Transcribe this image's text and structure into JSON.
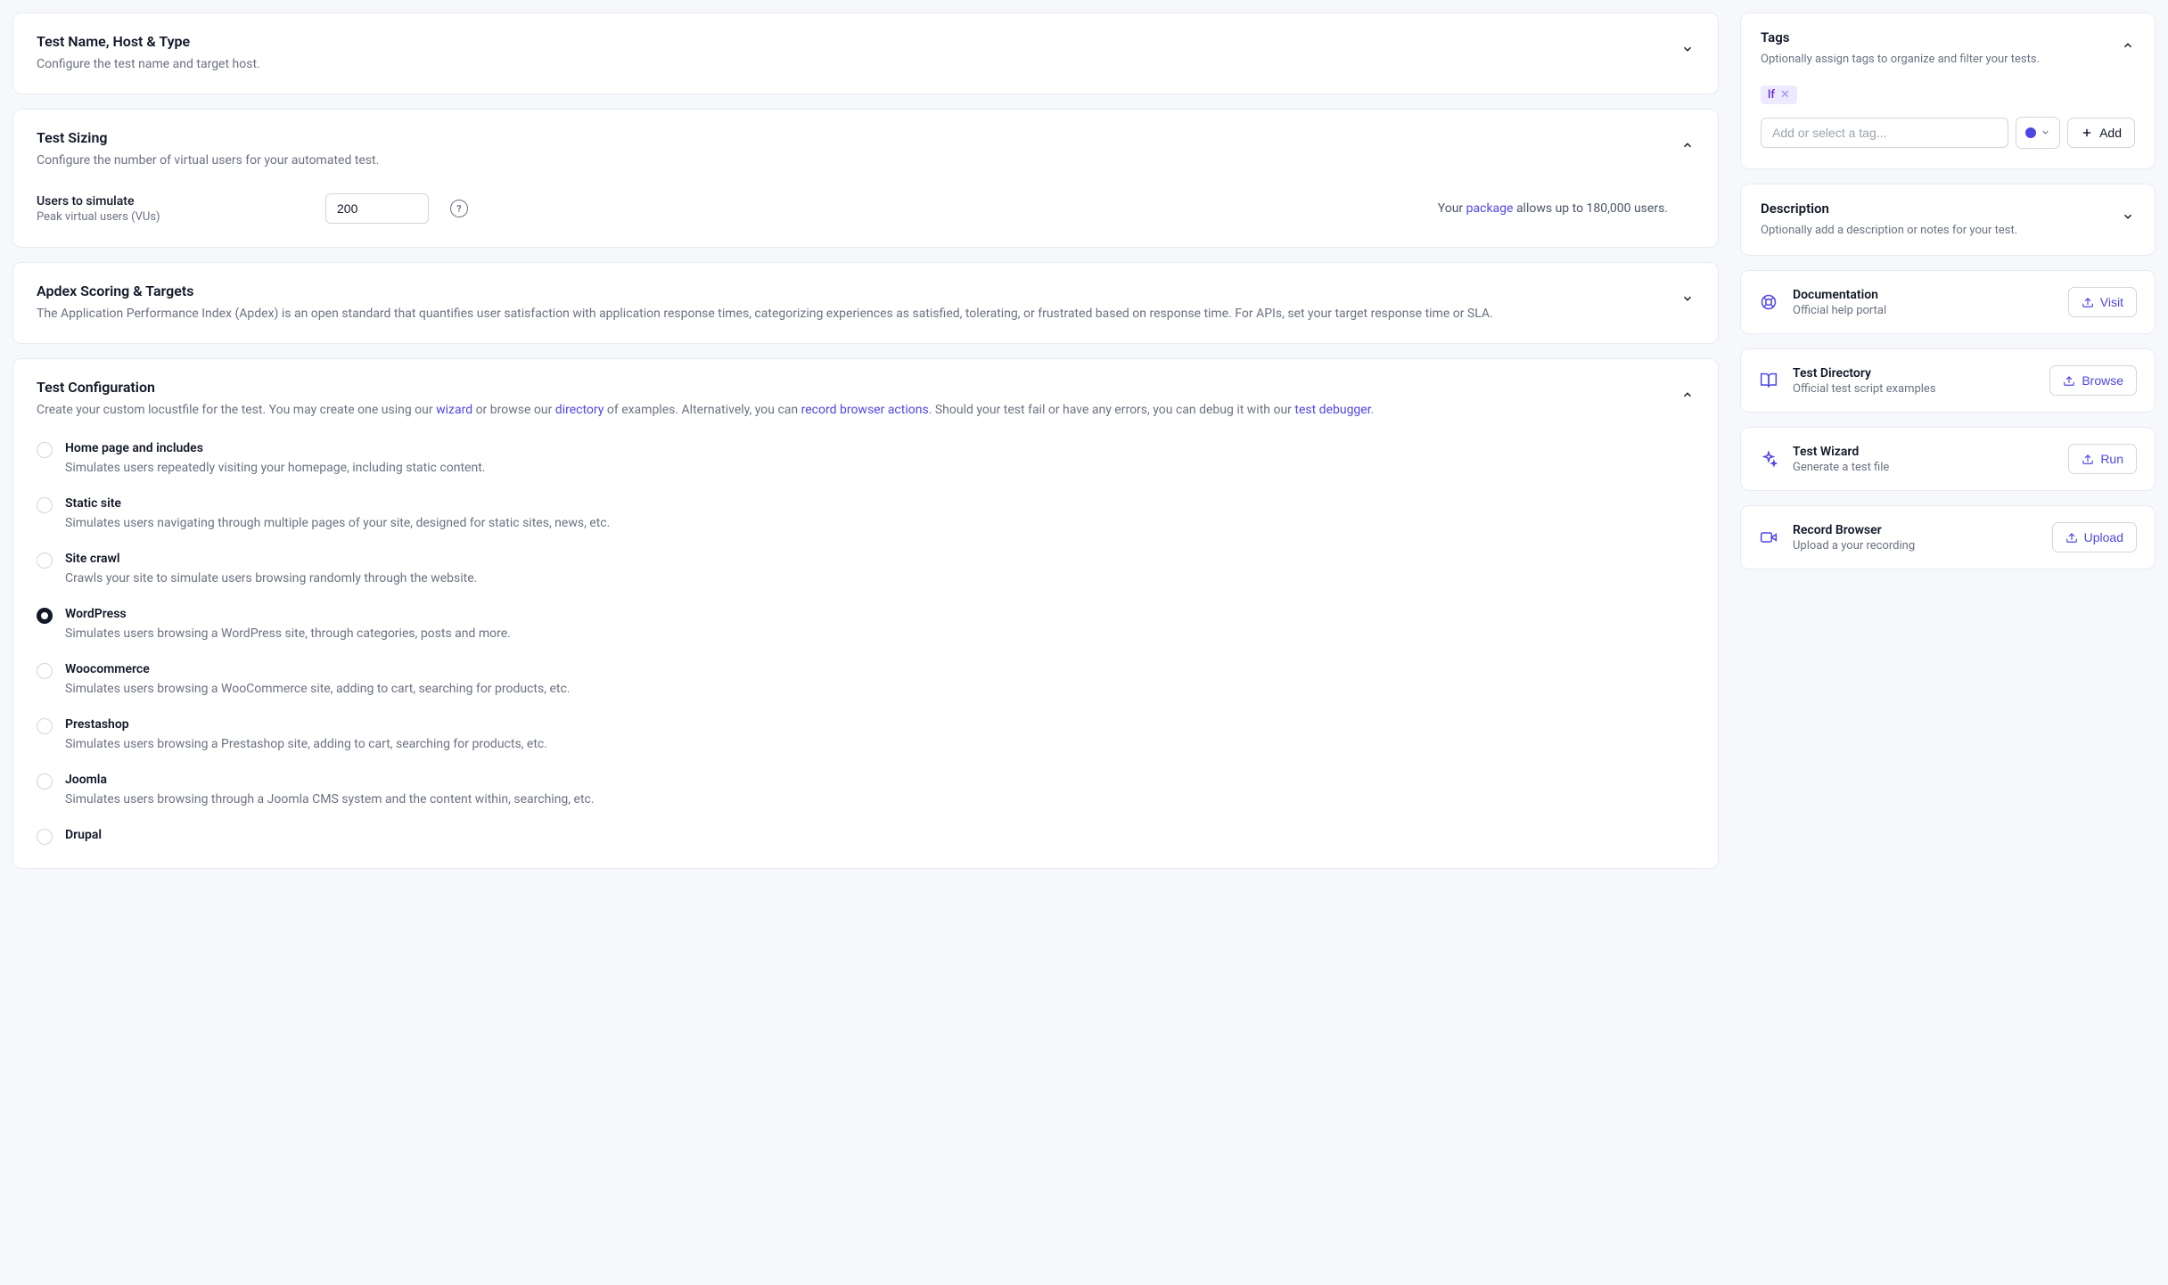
{
  "sections": {
    "nameHost": {
      "title": "Test Name, Host & Type",
      "subtitle": "Configure the test name and target host."
    },
    "sizing": {
      "title": "Test Sizing",
      "subtitle": "Configure the number of virtual users for your automated test.",
      "field_label": "Users to simulate",
      "field_hint": "Peak virtual users (VUs)",
      "value": "200",
      "note_prefix": "Your ",
      "note_link": "package",
      "note_suffix": " allows up to 180,000 users."
    },
    "apdex": {
      "title": "Apdex Scoring & Targets",
      "subtitle": "The Application Performance Index (Apdex) is an open standard that quantifies user satisfaction with application response times, categorizing experiences as satisfied, tolerating, or frustrated based on response time. For APIs, set your target response time or SLA."
    },
    "config": {
      "title": "Test Configuration",
      "sub_parts": {
        "p1": "Create your custom locustfile for the test. You may create one using our ",
        "wizard": "wizard",
        "p2": " or browse our ",
        "directory": "directory",
        "p3": " of examples. Alternatively, you can ",
        "record": "record browser actions",
        "p4": ". Should your test fail or have any errors, you can debug it with our ",
        "debugger": "test debugger",
        "p5": "."
      },
      "options": [
        {
          "title": "Home page and includes",
          "desc": "Simulates users repeatedly visiting your homepage, including static content.",
          "selected": false
        },
        {
          "title": "Static site",
          "desc": "Simulates users navigating through multiple pages of your site, designed for static sites, news, etc.",
          "selected": false
        },
        {
          "title": "Site crawl",
          "desc": "Crawls your site to simulate users browsing randomly through the website.",
          "selected": false
        },
        {
          "title": "WordPress",
          "desc": "Simulates users browsing a WordPress site, through categories, posts and more.",
          "selected": true
        },
        {
          "title": "Woocommerce",
          "desc": "Simulates users browsing a WooCommerce site, adding to cart, searching for products, etc.",
          "selected": false
        },
        {
          "title": "Prestashop",
          "desc": "Simulates users browsing a Prestashop site, adding to cart, searching for products, etc.",
          "selected": false
        },
        {
          "title": "Joomla",
          "desc": "Simulates users browsing through a Joomla CMS system and the content within, searching, etc.",
          "selected": false
        },
        {
          "title": "Drupal",
          "desc": "",
          "selected": false
        }
      ]
    }
  },
  "sidebar": {
    "tags": {
      "title": "Tags",
      "subtitle": "Optionally assign tags to organize and filter your tests.",
      "chip": "lf",
      "placeholder": "Add or select a tag...",
      "add_label": "Add"
    },
    "description": {
      "title": "Description",
      "subtitle": "Optionally add a description or notes for your test."
    },
    "actions": [
      {
        "icon": "life-ring",
        "title": "Documentation",
        "sub": "Official help portal",
        "btn": "Visit"
      },
      {
        "icon": "book",
        "title": "Test Directory",
        "sub": "Official test script examples",
        "btn": "Browse"
      },
      {
        "icon": "sparkle",
        "title": "Test Wizard",
        "sub": "Generate a test file",
        "btn": "Run"
      },
      {
        "icon": "video",
        "title": "Record Browser",
        "sub": "Upload a your recording",
        "btn": "Upload"
      }
    ]
  }
}
